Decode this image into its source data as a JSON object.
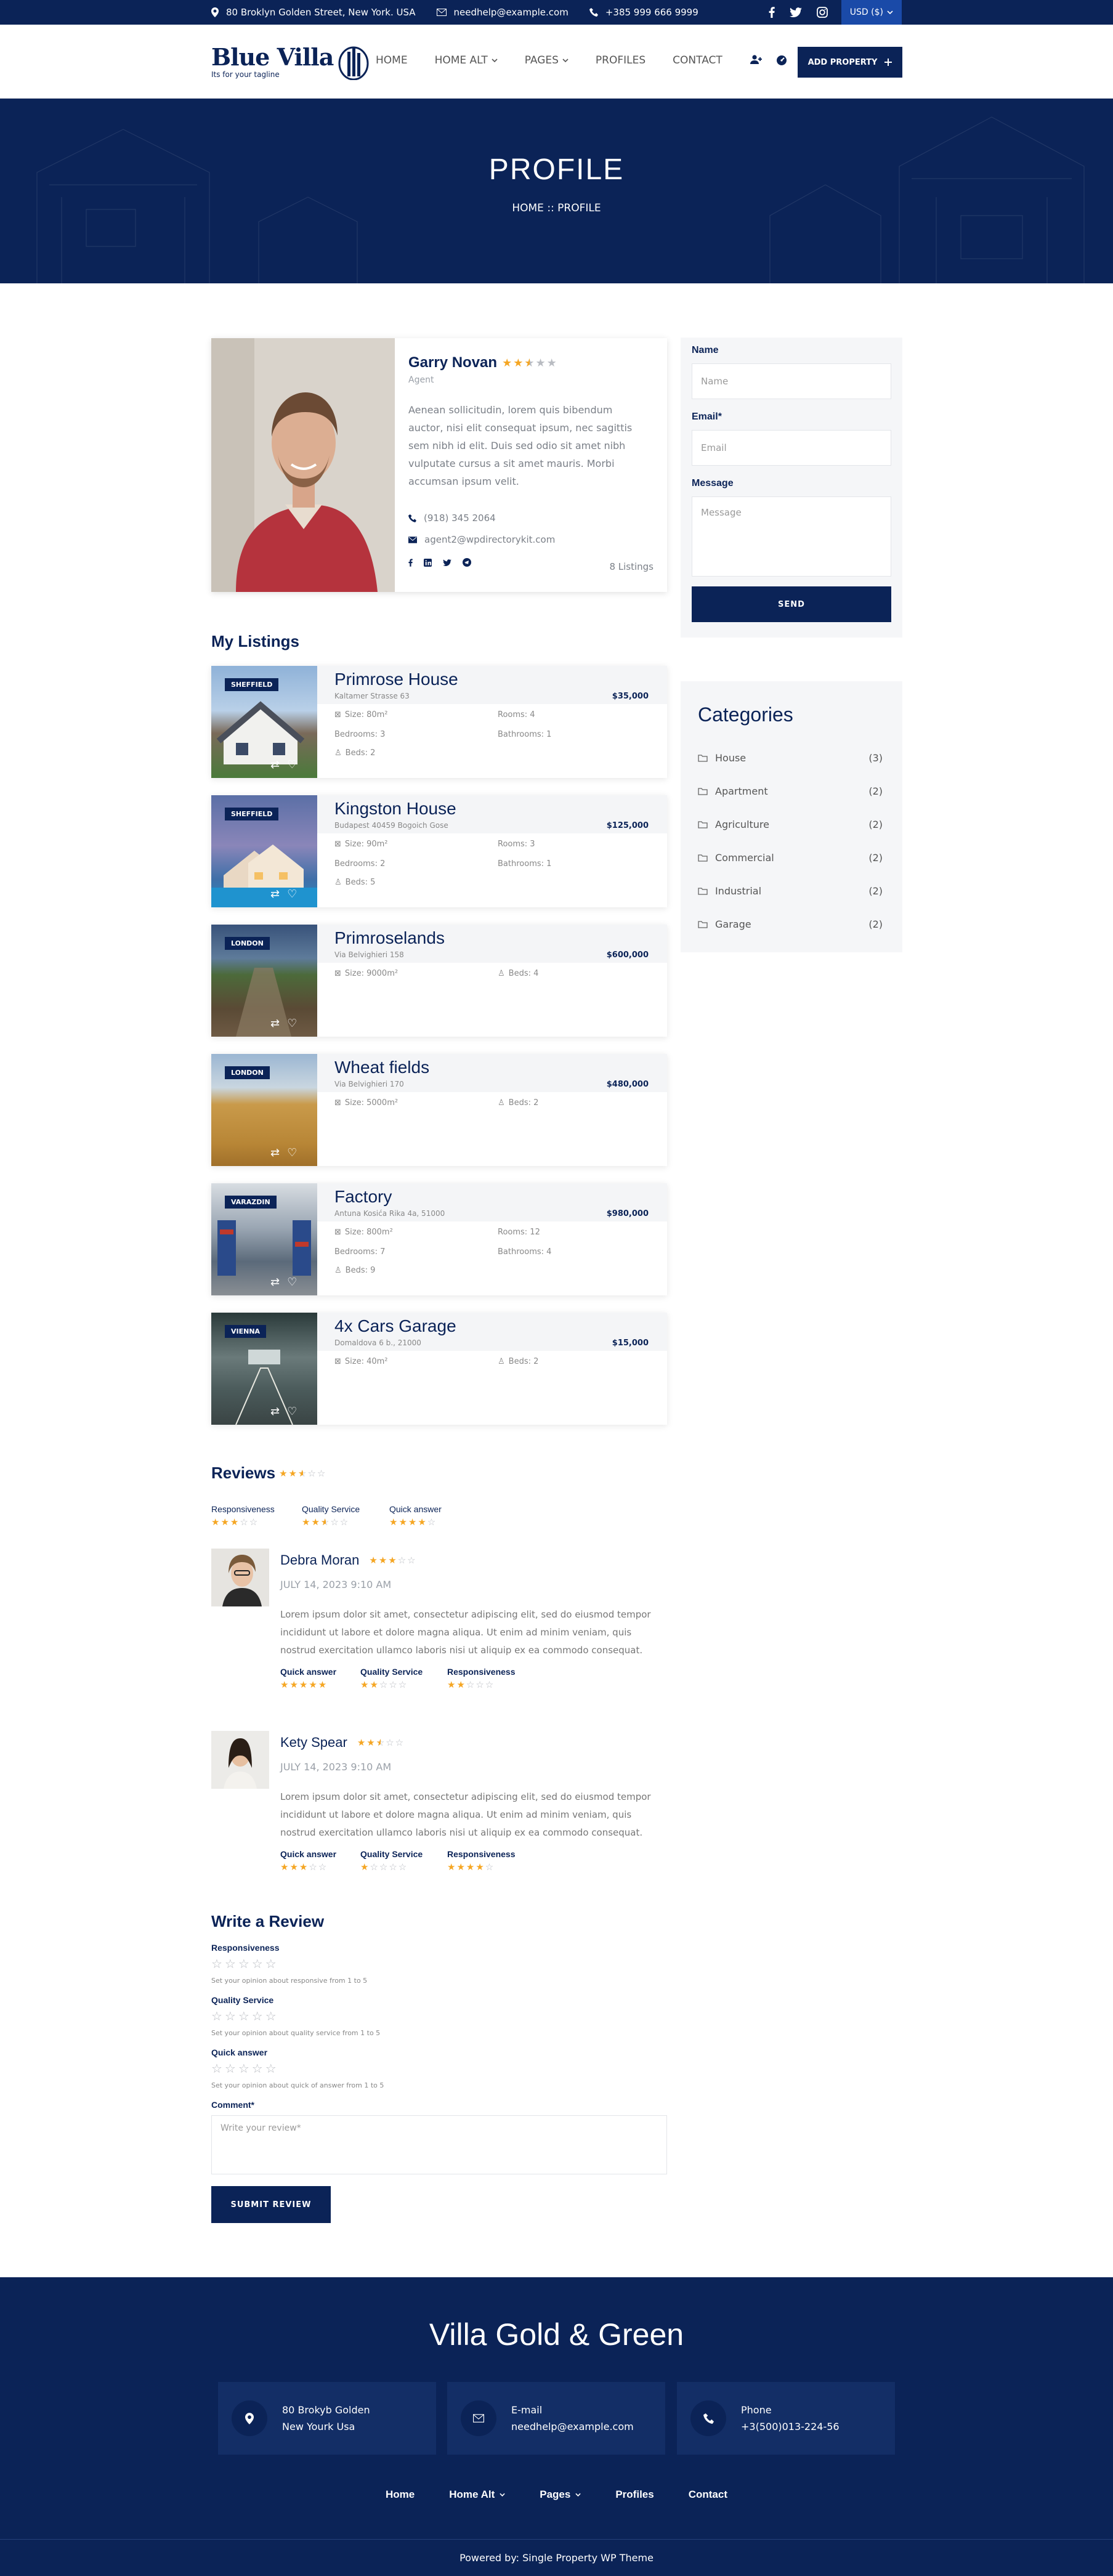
{
  "topbar": {
    "address": "80 Broklyn Golden Street, New York. USA",
    "email": "needhelp@example.com",
    "phone": "+385 999 666 9999",
    "currency": "USD ($)"
  },
  "header": {
    "logo_title": "Blue Villa",
    "logo_tagline": "Its for your tagline",
    "nav": [
      "HOME",
      "HOME ALT",
      "PAGES",
      "PROFILES",
      "CONTACT"
    ],
    "add_property": "ADD PROPERTY"
  },
  "hero": {
    "title": "PROFILE",
    "breadcrumb": "HOME :: PROFILE"
  },
  "profile": {
    "name": "Garry Novan",
    "role": "Agent",
    "rating": 2.5,
    "bio": "Aenean sollicitudin, lorem quis bibendum auctor, nisi elit consequat ipsum, nec sagittis sem nibh id elit. Duis sed odio sit amet nibh vulputate cursus a sit amet mauris. Morbi accumsan ipsum velit.",
    "phone": "(918) 345 2064",
    "email": "agent2@wpdirectorykit.com",
    "listings_count": "8 Listings"
  },
  "contact_form": {
    "name_label": "Name",
    "name_placeholder": "Name",
    "email_label": "Email*",
    "email_placeholder": "Email",
    "message_label": "Message",
    "message_placeholder": "Message",
    "send": "SEND"
  },
  "categories": {
    "title": "Categories",
    "items": [
      {
        "name": "House",
        "count": "(3)"
      },
      {
        "name": "Apartment",
        "count": "(2)"
      },
      {
        "name": "Agriculture",
        "count": "(2)"
      },
      {
        "name": "Commercial",
        "count": "(2)"
      },
      {
        "name": "Industrial",
        "count": "(2)"
      },
      {
        "name": "Garage",
        "count": "(2)"
      }
    ]
  },
  "listings": {
    "title": "My Listings",
    "items": [
      {
        "badge": "SHEFFIELD",
        "title": "Primrose House",
        "address": "Kaltamer Strasse 63",
        "price": "$35,000",
        "size": "Size: 80m²",
        "rooms": "Rooms: 4",
        "bedrooms": "Bedrooms: 3",
        "bathrooms": "Bathrooms: 1",
        "beds": "Beds: 2"
      },
      {
        "badge": "SHEFFIELD",
        "title": "Kingston House",
        "address": "Budapest 40459 Bogoich Gose",
        "price": "$125,000",
        "size": "Size: 90m²",
        "rooms": "Rooms: 3",
        "bedrooms": "Bedrooms: 2",
        "bathrooms": "Bathrooms: 1",
        "beds": "Beds: 5"
      },
      {
        "badge": "LONDON",
        "title": "Primroselands",
        "address": "Via Belvighieri 158",
        "price": "$600,000",
        "size": "Size: 9000m²",
        "beds": "Beds: 4"
      },
      {
        "badge": "LONDON",
        "title": "Wheat fields",
        "address": "Via Belvighieri 170",
        "price": "$480,000",
        "size": "Size: 5000m²",
        "beds": "Beds: 2"
      },
      {
        "badge": "VARAZDIN",
        "title": "Factory",
        "address": "Antuna Kosića Rika 4a, 51000",
        "price": "$980,000",
        "size": "Size: 800m²",
        "rooms": "Rooms: 12",
        "bedrooms": "Bedrooms: 7",
        "bathrooms": "Bathrooms: 4",
        "beds": "Beds: 9"
      },
      {
        "badge": "VIENNA",
        "title": "4x Cars Garage",
        "address": "Domaldova 6 b., 21000",
        "price": "$15,000",
        "size": "Size: 40m²",
        "beds": "Beds: 2"
      }
    ]
  },
  "reviews": {
    "title": "Reviews",
    "overall": 2.5,
    "summary": [
      {
        "label": "Responsiveness",
        "rating": 3
      },
      {
        "label": "Quality Service",
        "rating": 2.5
      },
      {
        "label": "Quick answer",
        "rating": 4
      }
    ],
    "items": [
      {
        "name": "Debra Moran",
        "rating": 3,
        "date": "JULY 14, 2023 9:10 AM",
        "text": "Lorem ipsum dolor sit amet, consectetur adipiscing elit, sed do eiusmod tempor incididunt ut labore et dolore magna aliqua. Ut enim ad minim veniam, quis nostrud exercitation ullamco laboris nisi ut aliquip ex ea commodo consequat.",
        "ratings": [
          {
            "label": "Quick answer",
            "rating": 5
          },
          {
            "label": "Quality Service",
            "rating": 2
          },
          {
            "label": "Responsiveness",
            "rating": 2
          }
        ]
      },
      {
        "name": "Kety Spear",
        "rating": 2.5,
        "date": "JULY 14, 2023 9:10 AM",
        "text": "Lorem ipsum dolor sit amet, consectetur adipiscing elit, sed do eiusmod tempor incididunt ut labore et dolore magna aliqua. Ut enim ad minim veniam, quis nostrud exercitation ullamco laboris nisi ut aliquip ex ea commodo consequat.",
        "ratings": [
          {
            "label": "Quick answer",
            "rating": 3
          },
          {
            "label": "Quality Service",
            "rating": 1
          },
          {
            "label": "Responsiveness",
            "rating": 4
          }
        ]
      }
    ]
  },
  "write_review": {
    "title": "Write a Review",
    "fields": [
      {
        "label": "Responsiveness",
        "hint": "Set your opinion about responsive from 1 to 5"
      },
      {
        "label": "Quality Service",
        "hint": "Set your opinion about quality service from 1 to 5"
      },
      {
        "label": "Quick answer",
        "hint": "Set your opinion about quick of answer from 1 to 5"
      }
    ],
    "comment_label": "Comment*",
    "comment_placeholder": "Write your review*",
    "submit": "SUBMIT REVIEW"
  },
  "footer": {
    "title": "Villa Gold & Green",
    "address_line1": "80 Brokyb Golden",
    "address_line2": "New Yourk Usa",
    "email_label": "E-mail",
    "email": "needhelp@example.com",
    "phone_label": "Phone",
    "phone": "+3(500)013-224-56",
    "nav": [
      "Home",
      "Home Alt",
      "Pages",
      "Profiles",
      "Contact"
    ],
    "copyright": "Powered by: Single Property WP Theme"
  },
  "colors": {
    "primary": "#0b2357",
    "accent_star": "#f5a623",
    "usd_bg": "#1a4aa8"
  }
}
